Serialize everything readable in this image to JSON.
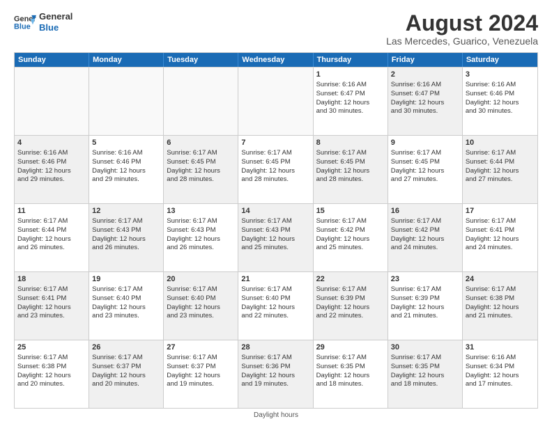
{
  "logo": {
    "line1": "General",
    "line2": "Blue"
  },
  "title": "August 2024",
  "subtitle": "Las Mercedes, Guarico, Venezuela",
  "header_days": [
    "Sunday",
    "Monday",
    "Tuesday",
    "Wednesday",
    "Thursday",
    "Friday",
    "Saturday"
  ],
  "footer": "Daylight hours",
  "weeks": [
    [
      {
        "day": "",
        "info": "",
        "empty": true
      },
      {
        "day": "",
        "info": "",
        "empty": true
      },
      {
        "day": "",
        "info": "",
        "empty": true
      },
      {
        "day": "",
        "info": "",
        "empty": true
      },
      {
        "day": "1",
        "info": "Sunrise: 6:16 AM\nSunset: 6:47 PM\nDaylight: 12 hours\nand 30 minutes.",
        "shaded": false
      },
      {
        "day": "2",
        "info": "Sunrise: 6:16 AM\nSunset: 6:47 PM\nDaylight: 12 hours\nand 30 minutes.",
        "shaded": true
      },
      {
        "day": "3",
        "info": "Sunrise: 6:16 AM\nSunset: 6:46 PM\nDaylight: 12 hours\nand 30 minutes.",
        "shaded": false
      }
    ],
    [
      {
        "day": "4",
        "info": "Sunrise: 6:16 AM\nSunset: 6:46 PM\nDaylight: 12 hours\nand 29 minutes.",
        "shaded": true
      },
      {
        "day": "5",
        "info": "Sunrise: 6:16 AM\nSunset: 6:46 PM\nDaylight: 12 hours\nand 29 minutes.",
        "shaded": false
      },
      {
        "day": "6",
        "info": "Sunrise: 6:17 AM\nSunset: 6:45 PM\nDaylight: 12 hours\nand 28 minutes.",
        "shaded": true
      },
      {
        "day": "7",
        "info": "Sunrise: 6:17 AM\nSunset: 6:45 PM\nDaylight: 12 hours\nand 28 minutes.",
        "shaded": false
      },
      {
        "day": "8",
        "info": "Sunrise: 6:17 AM\nSunset: 6:45 PM\nDaylight: 12 hours\nand 28 minutes.",
        "shaded": true
      },
      {
        "day": "9",
        "info": "Sunrise: 6:17 AM\nSunset: 6:45 PM\nDaylight: 12 hours\nand 27 minutes.",
        "shaded": false
      },
      {
        "day": "10",
        "info": "Sunrise: 6:17 AM\nSunset: 6:44 PM\nDaylight: 12 hours\nand 27 minutes.",
        "shaded": true
      }
    ],
    [
      {
        "day": "11",
        "info": "Sunrise: 6:17 AM\nSunset: 6:44 PM\nDaylight: 12 hours\nand 26 minutes.",
        "shaded": false
      },
      {
        "day": "12",
        "info": "Sunrise: 6:17 AM\nSunset: 6:43 PM\nDaylight: 12 hours\nand 26 minutes.",
        "shaded": true
      },
      {
        "day": "13",
        "info": "Sunrise: 6:17 AM\nSunset: 6:43 PM\nDaylight: 12 hours\nand 26 minutes.",
        "shaded": false
      },
      {
        "day": "14",
        "info": "Sunrise: 6:17 AM\nSunset: 6:43 PM\nDaylight: 12 hours\nand 25 minutes.",
        "shaded": true
      },
      {
        "day": "15",
        "info": "Sunrise: 6:17 AM\nSunset: 6:42 PM\nDaylight: 12 hours\nand 25 minutes.",
        "shaded": false
      },
      {
        "day": "16",
        "info": "Sunrise: 6:17 AM\nSunset: 6:42 PM\nDaylight: 12 hours\nand 24 minutes.",
        "shaded": true
      },
      {
        "day": "17",
        "info": "Sunrise: 6:17 AM\nSunset: 6:41 PM\nDaylight: 12 hours\nand 24 minutes.",
        "shaded": false
      }
    ],
    [
      {
        "day": "18",
        "info": "Sunrise: 6:17 AM\nSunset: 6:41 PM\nDaylight: 12 hours\nand 23 minutes.",
        "shaded": true
      },
      {
        "day": "19",
        "info": "Sunrise: 6:17 AM\nSunset: 6:40 PM\nDaylight: 12 hours\nand 23 minutes.",
        "shaded": false
      },
      {
        "day": "20",
        "info": "Sunrise: 6:17 AM\nSunset: 6:40 PM\nDaylight: 12 hours\nand 23 minutes.",
        "shaded": true
      },
      {
        "day": "21",
        "info": "Sunrise: 6:17 AM\nSunset: 6:40 PM\nDaylight: 12 hours\nand 22 minutes.",
        "shaded": false
      },
      {
        "day": "22",
        "info": "Sunrise: 6:17 AM\nSunset: 6:39 PM\nDaylight: 12 hours\nand 22 minutes.",
        "shaded": true
      },
      {
        "day": "23",
        "info": "Sunrise: 6:17 AM\nSunset: 6:39 PM\nDaylight: 12 hours\nand 21 minutes.",
        "shaded": false
      },
      {
        "day": "24",
        "info": "Sunrise: 6:17 AM\nSunset: 6:38 PM\nDaylight: 12 hours\nand 21 minutes.",
        "shaded": true
      }
    ],
    [
      {
        "day": "25",
        "info": "Sunrise: 6:17 AM\nSunset: 6:38 PM\nDaylight: 12 hours\nand 20 minutes.",
        "shaded": false
      },
      {
        "day": "26",
        "info": "Sunrise: 6:17 AM\nSunset: 6:37 PM\nDaylight: 12 hours\nand 20 minutes.",
        "shaded": true
      },
      {
        "day": "27",
        "info": "Sunrise: 6:17 AM\nSunset: 6:37 PM\nDaylight: 12 hours\nand 19 minutes.",
        "shaded": false
      },
      {
        "day": "28",
        "info": "Sunrise: 6:17 AM\nSunset: 6:36 PM\nDaylight: 12 hours\nand 19 minutes.",
        "shaded": true
      },
      {
        "day": "29",
        "info": "Sunrise: 6:17 AM\nSunset: 6:35 PM\nDaylight: 12 hours\nand 18 minutes.",
        "shaded": false
      },
      {
        "day": "30",
        "info": "Sunrise: 6:17 AM\nSunset: 6:35 PM\nDaylight: 12 hours\nand 18 minutes.",
        "shaded": true
      },
      {
        "day": "31",
        "info": "Sunrise: 6:16 AM\nSunset: 6:34 PM\nDaylight: 12 hours\nand 17 minutes.",
        "shaded": false
      }
    ]
  ]
}
